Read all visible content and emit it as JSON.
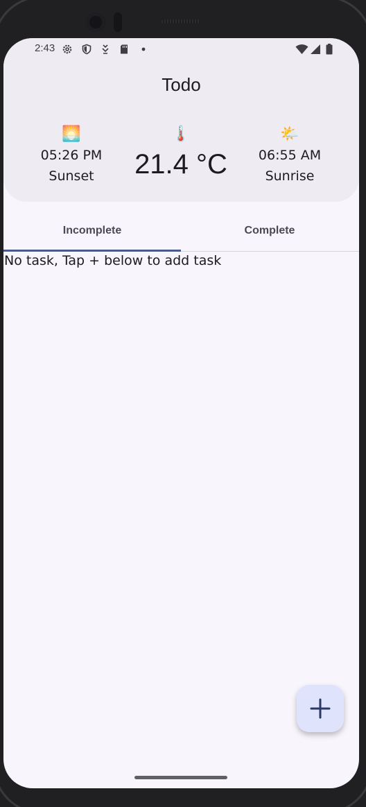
{
  "status_bar": {
    "time": "2:43",
    "left_icons": [
      "gear-icon",
      "shield-icon",
      "download-icon",
      "sd-card-icon",
      "dot-icon"
    ],
    "right_icons": [
      "wifi-icon",
      "signal-icon",
      "battery-icon"
    ]
  },
  "app": {
    "title": "Todo"
  },
  "weather": {
    "sunset": {
      "emoji": "🌅",
      "time": "05:26 PM",
      "label": "Sunset"
    },
    "temperature": {
      "emoji": "🌡️",
      "value": "21.4 °C"
    },
    "sunrise": {
      "emoji": "🌤️",
      "time": "06:55 AM",
      "label": "Sunrise"
    }
  },
  "tabs": [
    {
      "label": "Incomplete",
      "selected": true
    },
    {
      "label": "Complete",
      "selected": false
    }
  ],
  "tasks": {
    "empty_message": "No task, Tap + below to add task"
  },
  "fab": {
    "icon": "plus-icon",
    "color": "#dfe3fb"
  },
  "colors": {
    "accent": "#4a5a8c",
    "header_bg": "#eeecf2",
    "screen_bg": "#f8f5fc"
  }
}
